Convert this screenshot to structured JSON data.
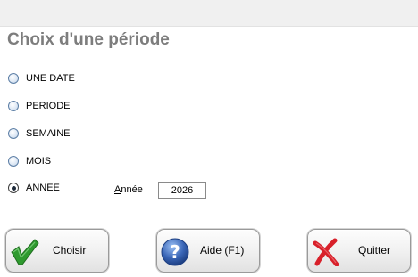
{
  "dialog": {
    "title": "Choix d'une période"
  },
  "period_options": [
    {
      "label": "UNE DATE",
      "selected": false
    },
    {
      "label": "PERIODE",
      "selected": false
    },
    {
      "label": "SEMAINE",
      "selected": false
    },
    {
      "label": "MOIS",
      "selected": false
    },
    {
      "label": "ANNEE",
      "selected": true
    }
  ],
  "year": {
    "label_accel": "A",
    "label_rest": "nnée",
    "value": "2026"
  },
  "buttons": {
    "choose_label": "Choisir",
    "choose_icon": "checkmark-icon",
    "help_label": "Aide (F1)",
    "help_icon": "help-question-icon",
    "quit_label": "Quitter",
    "quit_icon": "red-x-icon"
  },
  "colors": {
    "title": "#7d7d7d",
    "check_green": "#2f9a2f",
    "help_blue": "#3a66b7",
    "quit_red": "#d8202a"
  }
}
